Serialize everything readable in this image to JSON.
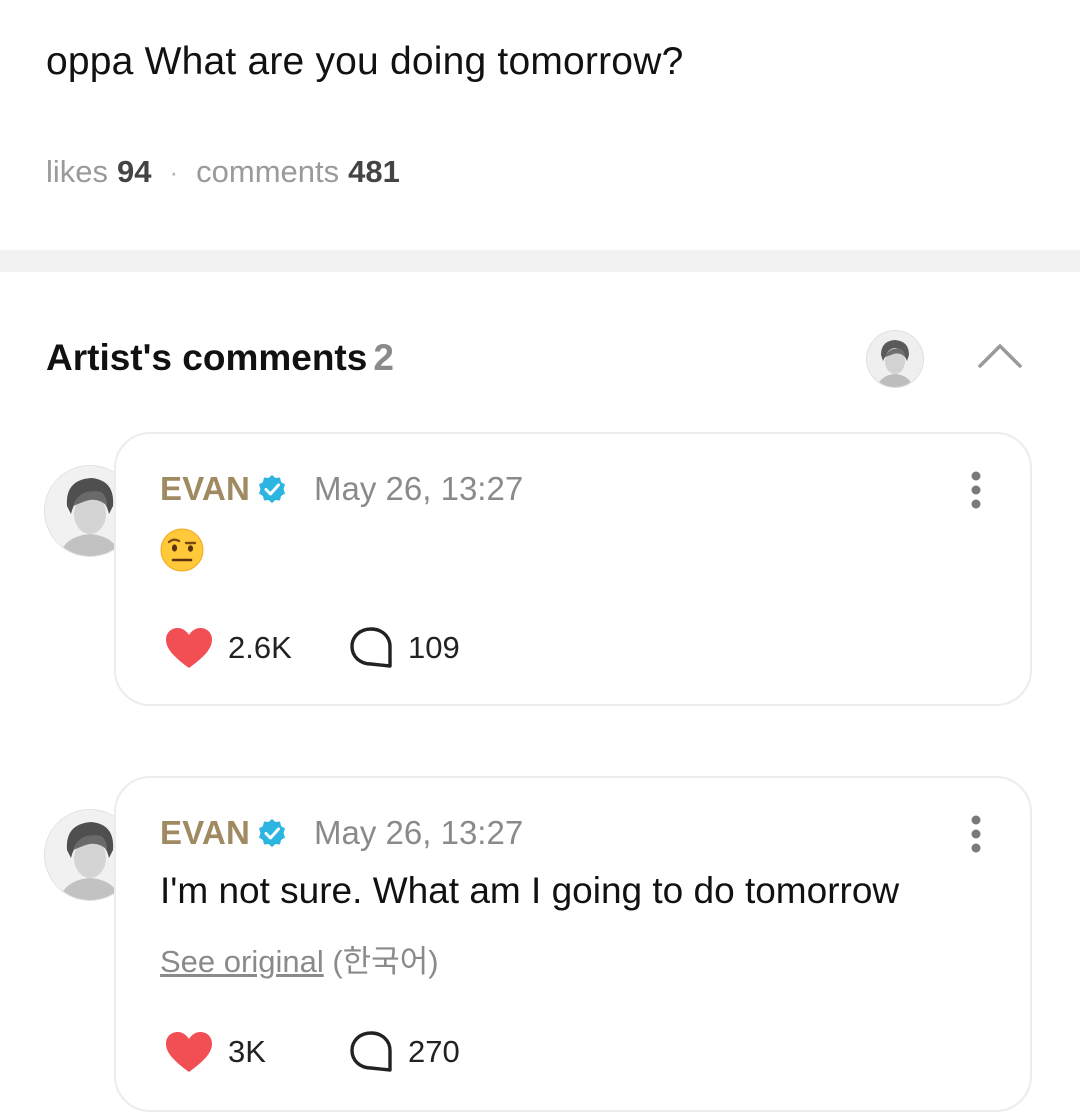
{
  "post": {
    "text": "oppa What are you doing tomorrow?",
    "likes_label": "likes",
    "likes_count": "94",
    "separator": "·",
    "comments_label": "comments",
    "comments_count": "481"
  },
  "artist_comments": {
    "title": "Artist's comments",
    "count": "2",
    "collapse_icon": "chevron-up-icon"
  },
  "comments": [
    {
      "author": "EVAN",
      "verified_icon": "verified-badge-icon",
      "time": "May 26, 13:27",
      "content_emoji": "face-with-raised-eyebrow",
      "likes": "2.6K",
      "replies": "109"
    },
    {
      "author": "EVAN",
      "verified_icon": "verified-badge-icon",
      "time": "May 26, 13:27",
      "text": "I'm not sure. What am I going to do tomorrow",
      "see_original": "See original",
      "original_language": "(한국어)",
      "likes": "3K",
      "replies": "270"
    }
  ],
  "colors": {
    "author": "#a08a62",
    "verified": "#2bb5e0",
    "heart": "#f24f55",
    "muted": "#8a8a8a"
  }
}
